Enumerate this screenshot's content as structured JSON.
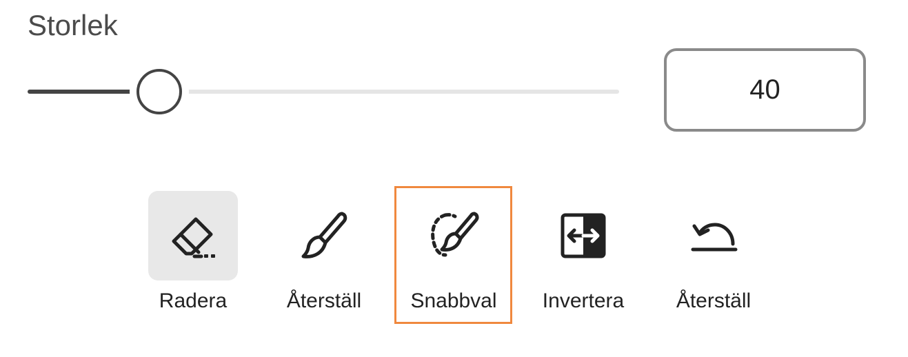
{
  "size": {
    "label": "Storlek",
    "value": "40",
    "slider_fraction": 0.22
  },
  "tools": [
    {
      "label": "Radera",
      "icon": "eraser-icon",
      "active": true
    },
    {
      "label": "Återställ",
      "icon": "brush-icon",
      "active": false
    },
    {
      "label": "Snabbval",
      "icon": "quick-select-brush-icon",
      "active": false,
      "highlighted": true
    },
    {
      "label": "Invertera",
      "icon": "invert-icon",
      "active": false
    },
    {
      "label": "Återställ",
      "icon": "undo-arc-icon",
      "active": false
    }
  ],
  "colors": {
    "highlight": "#f0883e",
    "active_background": "#e8e8e8",
    "slider_fill": "#444444",
    "slider_track": "#e5e5e5"
  }
}
